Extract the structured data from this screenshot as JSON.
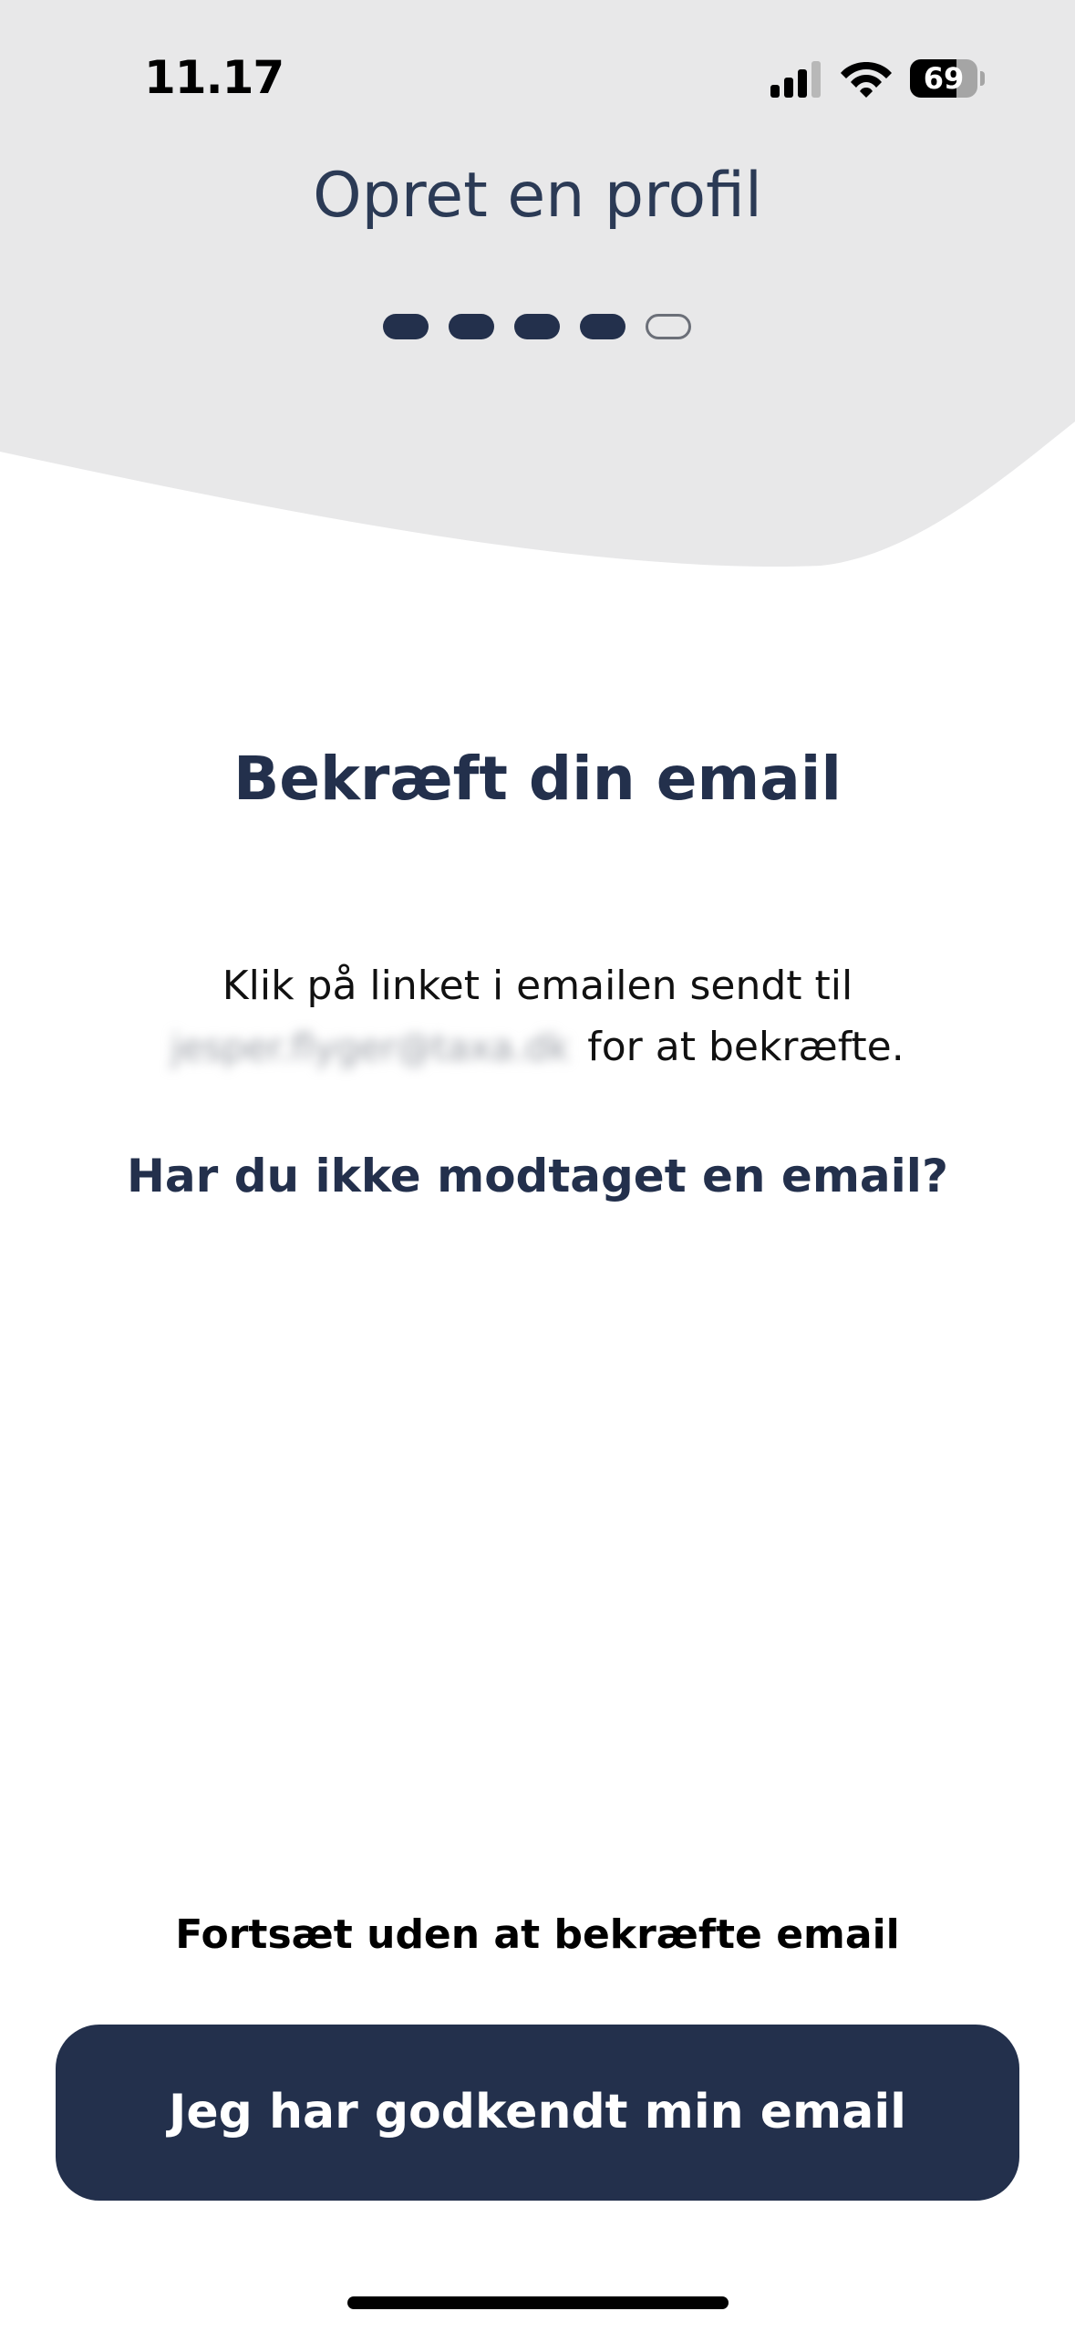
{
  "status_bar": {
    "time": "11.17",
    "battery_level": "69",
    "battery_fraction": 0.69,
    "icons": [
      "signal-icon",
      "wifi-icon",
      "battery-icon"
    ]
  },
  "header": {
    "title": "Opret en profil",
    "steps_total": 5,
    "steps_completed": 4
  },
  "main": {
    "title": "Bekræft din email",
    "instruction_prefix": "Klik på linket i emailen sendt til",
    "email": "jesper.flyger@taxa.dk",
    "instruction_suffix": "for at bekræfte.",
    "resend_link": "Har du ikke modtaget en email?"
  },
  "footer": {
    "skip_link": "Fortsæt uden at bekræfte email",
    "confirm_button": "Jeg har godkendt min email"
  },
  "colors": {
    "header_background": "#e8e8e9",
    "primary": "#23304c",
    "step_inactive_border": "#6b6f78"
  }
}
